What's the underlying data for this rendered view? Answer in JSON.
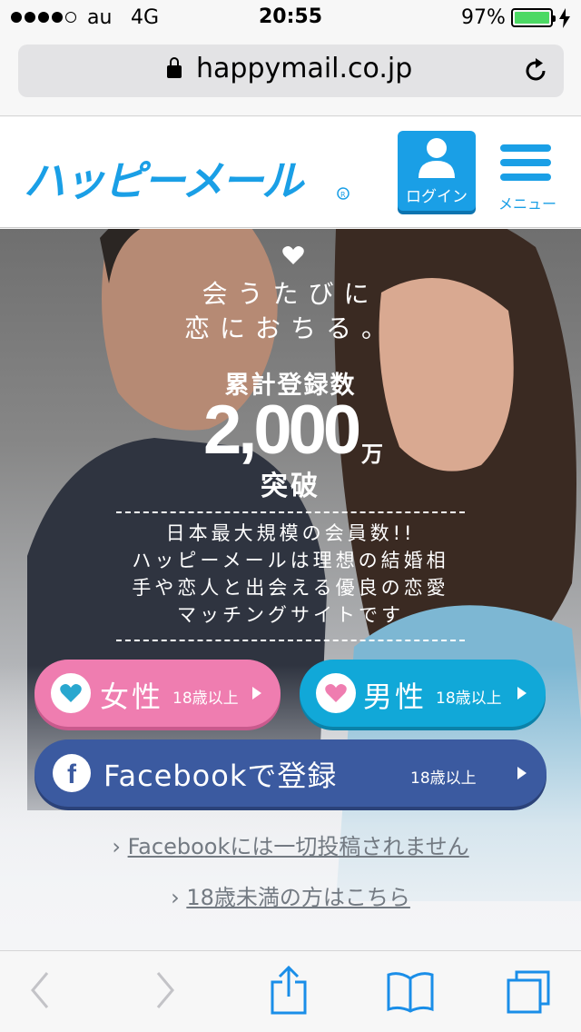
{
  "status_bar": {
    "carrier": "au",
    "network": "4G",
    "time": "20:55",
    "battery_percent": "97%",
    "battery_level": 0.97,
    "battery_color": "#4cd964"
  },
  "browser": {
    "url": "happymail.co.jp",
    "icons": [
      "lock-icon",
      "reload-icon"
    ]
  },
  "site_header": {
    "logo_text": "ハッピーメール",
    "login_label": "ログイン",
    "menu_label": "メニュー",
    "accent_color": "#1a9fe6"
  },
  "hero": {
    "tagline_1": "会うたびに",
    "tagline_2": "恋におちる。",
    "registered_label": "累計登録数",
    "registered_count": "2,000",
    "registered_unit": "万",
    "registered_suffix": "突破",
    "description": [
      "日本最大規模の会員数!!",
      "ハッピーメールは理想の結婚相",
      "手や恋人と出会える優良の恋愛",
      "マッチングサイトです"
    ]
  },
  "buttons": {
    "female": {
      "label": "女性",
      "age": "18歳以上",
      "color": "#ef7db0"
    },
    "male": {
      "label": "男性",
      "age": "18歳以上",
      "color": "#11a8d8"
    },
    "facebook": {
      "label": "Facebookで登録",
      "age": "18歳以上",
      "color": "#3b5aa0"
    }
  },
  "links": {
    "facebook_note": "Facebookには一切投稿されません",
    "under18": "18歳未満の方はこちら"
  },
  "toolbar": {
    "icons": [
      "back-icon",
      "forward-icon",
      "share-icon",
      "bookmarks-icon",
      "tabs-icon"
    ]
  }
}
